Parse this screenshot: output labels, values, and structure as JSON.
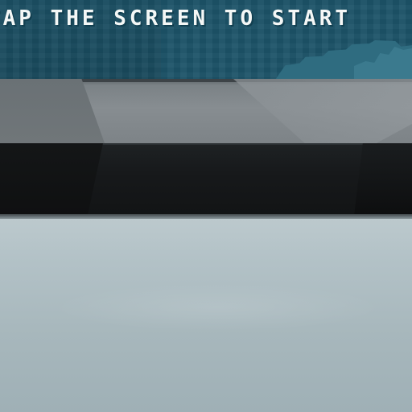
{
  "game": {
    "screen_prompt": "TAP THE SCREEN TO START"
  },
  "colors": {
    "screen_bg": "#1d5468",
    "text": "#f4f7f6",
    "bezel_gray": "#808689",
    "bezel_dark": "#17191b",
    "floor": "#a7b7bc"
  }
}
